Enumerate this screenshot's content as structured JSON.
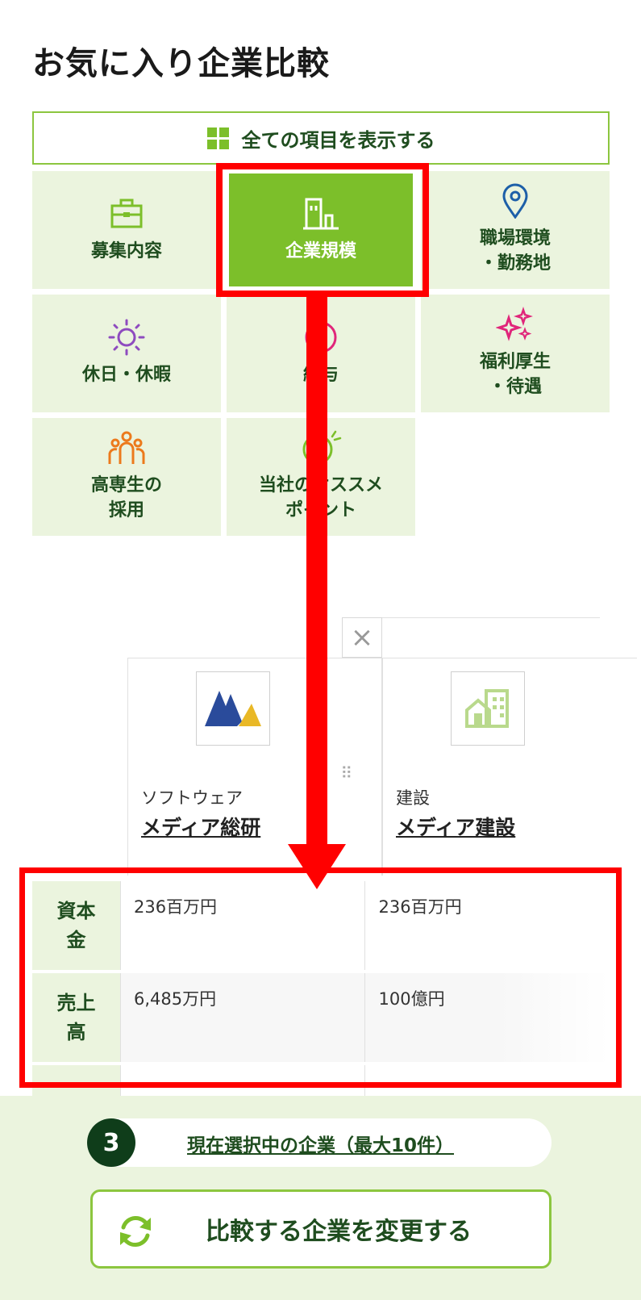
{
  "page": {
    "title": "お気に入り企業比較"
  },
  "show_all": {
    "label": "全ての項目を表示する"
  },
  "categories": [
    {
      "label": "募集内容",
      "icon": "briefcase-icon"
    },
    {
      "label": "企業規模",
      "icon": "building-icon",
      "active": true
    },
    {
      "label": "職場環境\n・勤務地",
      "icon": "location-pin-icon"
    },
    {
      "label": "休日・休暇",
      "icon": "sun-icon"
    },
    {
      "label": "給与",
      "icon": "yen-coin-icon"
    },
    {
      "label": "福利厚生\n・待遇",
      "icon": "sparkle-icon"
    },
    {
      "label": "高専生の\n採用",
      "icon": "people-icon"
    },
    {
      "label": "当社のオススメ\nポイント",
      "icon": "smile-icon"
    }
  ],
  "companies": [
    {
      "industry": "ソフトウェア",
      "name": "メディア総研",
      "logo": "media-souken-logo"
    },
    {
      "industry": "建設",
      "name": "メディア建設",
      "logo": "building-placeholder-logo"
    }
  ],
  "table": {
    "rows": [
      {
        "header": "資本\n金",
        "values": [
          "236百万円",
          "236百万円"
        ]
      },
      {
        "header": "売上\n高",
        "values": [
          "6,485万円",
          "100億円"
        ]
      }
    ]
  },
  "footer": {
    "selected_count": "3",
    "selected_label": "現在選択中の企業（最大10件）",
    "change_label": "比較する企業を変更する"
  },
  "colors": {
    "accent": "#7cbf2a",
    "dark_green": "#1f4d1f",
    "highlight": "#ff0000",
    "tile_bg": "#ebf4de"
  }
}
